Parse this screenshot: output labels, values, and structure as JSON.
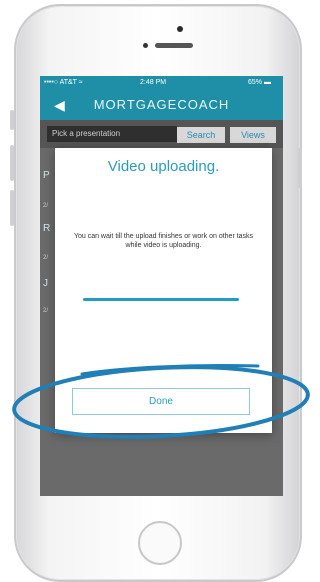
{
  "status_bar": {
    "carrier": "••••○ AT&T ≈",
    "time": "2:48 PM",
    "battery": "65% ▬"
  },
  "nav": {
    "back_icon": "back-arrow-icon",
    "title": "MORTGAGECOACH"
  },
  "toolbar": {
    "pick_label": "Pick a presentation",
    "search_label": "Search",
    "views_label": "Views"
  },
  "list": {
    "items": [
      {
        "letter": "P",
        "date": "2/"
      },
      {
        "letter": "R",
        "date": "2/"
      },
      {
        "letter": "J",
        "date": "2/"
      }
    ]
  },
  "modal": {
    "title": "Video uploading.",
    "message": "You can wait till the upload finishes or work on other tasks while video is uploading.",
    "done_label": "Done"
  },
  "colors": {
    "accent": "#1e8fa7",
    "title_blue": "#2b9bbd",
    "annotation": "#1f7fb6"
  }
}
